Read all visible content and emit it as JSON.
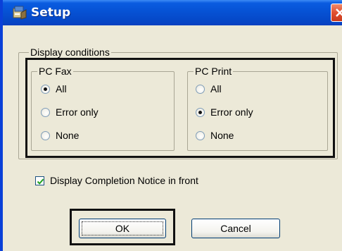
{
  "window": {
    "title": "Setup",
    "icon": "setup-app-icon",
    "close_icon": "close-icon"
  },
  "display_conditions": {
    "label": "Display conditions",
    "pc_fax": {
      "label": "PC Fax",
      "options": [
        "All",
        "Error only",
        "None"
      ],
      "selected": "All"
    },
    "pc_print": {
      "label": "PC Print",
      "options": [
        "All",
        "Error only",
        "None"
      ],
      "selected": "Error only"
    }
  },
  "completion_notice": {
    "label": "Display Completion Notice in front",
    "checked": true
  },
  "buttons": {
    "ok_label": "OK",
    "cancel_label": "Cancel"
  }
}
